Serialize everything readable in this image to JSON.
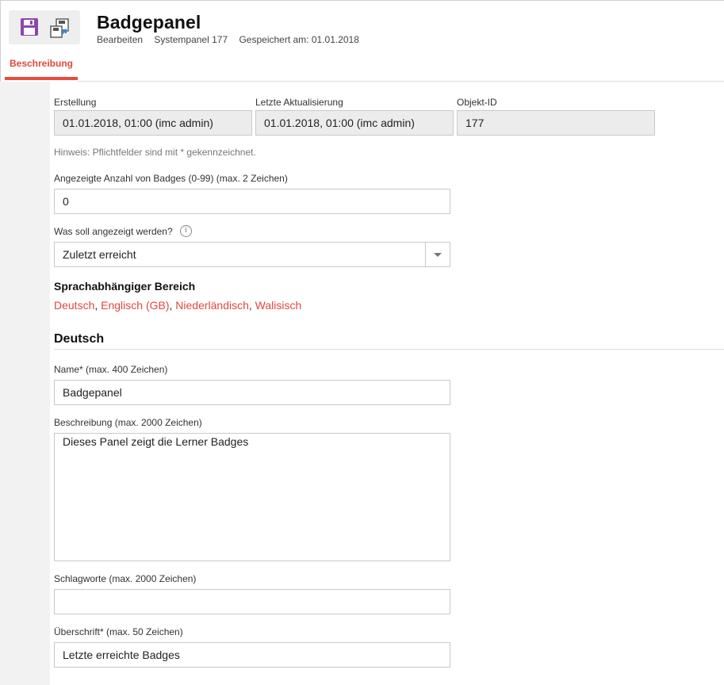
{
  "header": {
    "title": "Badgepanel",
    "meta": [
      "Bearbeiten",
      "Systempanel 177",
      "Gespeichert am: 01.01.2018"
    ]
  },
  "toolbar": {
    "save_icon": "floppy-disk-icon",
    "save_as_icon": "save-copy-icon",
    "accent_color": "#8e44ad"
  },
  "tabs": [
    {
      "label": "Beschreibung",
      "active": true
    }
  ],
  "info": {
    "creation": {
      "label": "Erstellung",
      "value": "01.01.2018, 01:00 (imc admin)"
    },
    "last_update": {
      "label": "Letzte Aktualisierung",
      "value": "01.01.2018, 01:00 (imc admin)"
    },
    "object_id": {
      "label": "Objekt-ID",
      "value": "177"
    }
  },
  "hint": "Hinweis: Pflichtfelder sind mit * gekennzeichnet.",
  "badge_count": {
    "label": "Angezeigte Anzahl von Badges (0-99) (max. 2 Zeichen)",
    "value": "0"
  },
  "display": {
    "label": "Was soll angezeigt werden?",
    "info_icon": "i",
    "value": "Zuletzt erreicht"
  },
  "language_section": {
    "title": "Sprachabhängiger Bereich",
    "languages": [
      "Deutsch",
      "Englisch (GB)",
      "Niederländisch",
      "Walisisch"
    ],
    "separator": ", "
  },
  "language_block": {
    "heading": "Deutsch",
    "name": {
      "label": "Name* (max. 400 Zeichen)",
      "value": "Badgepanel"
    },
    "description": {
      "label": "Beschreibung (max. 2000 Zeichen)",
      "value": "Dieses Panel zeigt die Lerner Badges"
    },
    "keywords": {
      "label": "Schlagworte (max. 2000 Zeichen)",
      "value": ""
    },
    "headline": {
      "label": "Überschrift* (max. 50 Zeichen)",
      "value": "Letzte erreichte Badges"
    }
  },
  "colors": {
    "accent_red": "#e74c3c",
    "link_red": "#e0483e"
  }
}
